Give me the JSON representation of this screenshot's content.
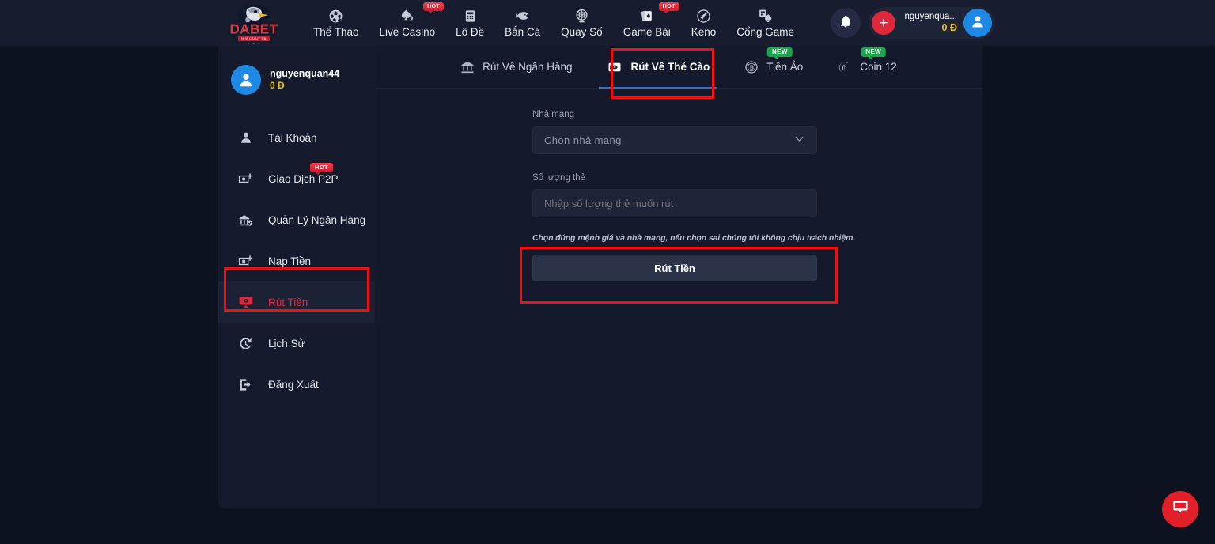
{
  "header": {
    "logo": {
      "word": "DABET",
      "sub": "NHÀ CÁI UY TÍN",
      "stars": "★ ★ ★"
    },
    "nav": [
      {
        "label": "Thể Thao",
        "icon": "soccer-ball-icon",
        "badge": ""
      },
      {
        "label": "Live Casino",
        "icon": "spade-cards-icon",
        "badge": "HOT"
      },
      {
        "label": "Lô Đề",
        "icon": "lottery-ticket-icon",
        "badge": ""
      },
      {
        "label": "Bắn Cá",
        "icon": "fish-icon",
        "badge": ""
      },
      {
        "label": "Quay Số",
        "icon": "lottery-ball-icon",
        "badge": ""
      },
      {
        "label": "Game Bài",
        "icon": "playing-cards-icon",
        "badge": "HOT"
      },
      {
        "label": "Keno",
        "icon": "keno-icon",
        "badge": ""
      },
      {
        "label": "Cổng Game",
        "icon": "game-portal-icon",
        "badge": ""
      }
    ],
    "bell_icon": "bell-icon",
    "deposit_plus": "+",
    "wallet": {
      "name": "nguyenqua...",
      "balance": "0 Đ"
    },
    "avatar_icon": "user-avatar-icon"
  },
  "sidebar": {
    "user": {
      "name": "nguyenquan44",
      "balance": "0 Đ",
      "avatar_icon": "user-avatar-icon"
    },
    "items": [
      {
        "label": "Tài Khoản",
        "icon": "user-icon",
        "badge": "",
        "active": false
      },
      {
        "label": "Giao Dịch P2P",
        "icon": "money-plus-icon",
        "badge": "HOT",
        "active": false
      },
      {
        "label": "Quản Lý Ngân Hàng",
        "icon": "bank-check-icon",
        "badge": "",
        "active": false
      },
      {
        "label": "Nạp Tiền",
        "icon": "money-plus-icon",
        "badge": "",
        "active": false
      },
      {
        "label": "Rút Tiền",
        "icon": "money-withdraw-icon",
        "badge": "",
        "active": true
      },
      {
        "label": "Lịch Sử",
        "icon": "history-clock-icon",
        "badge": "",
        "active": false
      },
      {
        "label": "Đăng Xuất",
        "icon": "logout-icon",
        "badge": "",
        "active": false
      }
    ]
  },
  "tabs": [
    {
      "label": "Rút Về Ngân Hàng",
      "icon": "bank-icon",
      "badge": "",
      "active": false
    },
    {
      "label": "Rút Về Thẻ Cào",
      "icon": "scratch-card-icon",
      "badge": "",
      "active": true
    },
    {
      "label": "Tiền Ảo",
      "icon": "bitcoin-icon",
      "badge": "NEW",
      "active": false
    },
    {
      "label": "Coin 12",
      "icon": "coin12-icon",
      "badge": "NEW",
      "active": false
    }
  ],
  "form": {
    "provider_label": "Nhà mạng",
    "provider_value": "Chọn nhà mạng",
    "provider_caret_icon": "chevron-down-icon",
    "quantity_label": "Số lượng thẻ",
    "quantity_placeholder": "Nhập số lượng thẻ muốn rút",
    "quantity_value": "",
    "note": "Chọn đúng mệnh giá và nhà mạng, nếu chọn sai chúng tôi không chịu trách nhiệm.",
    "submit_label": "Rút Tiền"
  },
  "chat": {
    "icon": "chat-bubble-icon"
  },
  "colors": {
    "page_bg": "#0d1220",
    "header_bg": "#171d2e",
    "sidebar_bg": "#151b2c",
    "content_bg": "#141a2b",
    "accent_red": "#e0283c",
    "accent_blue": "#2f6fd0",
    "gold": "#e8c21a",
    "green_badge": "#17a84a",
    "annotation_red": "#ee1111"
  }
}
